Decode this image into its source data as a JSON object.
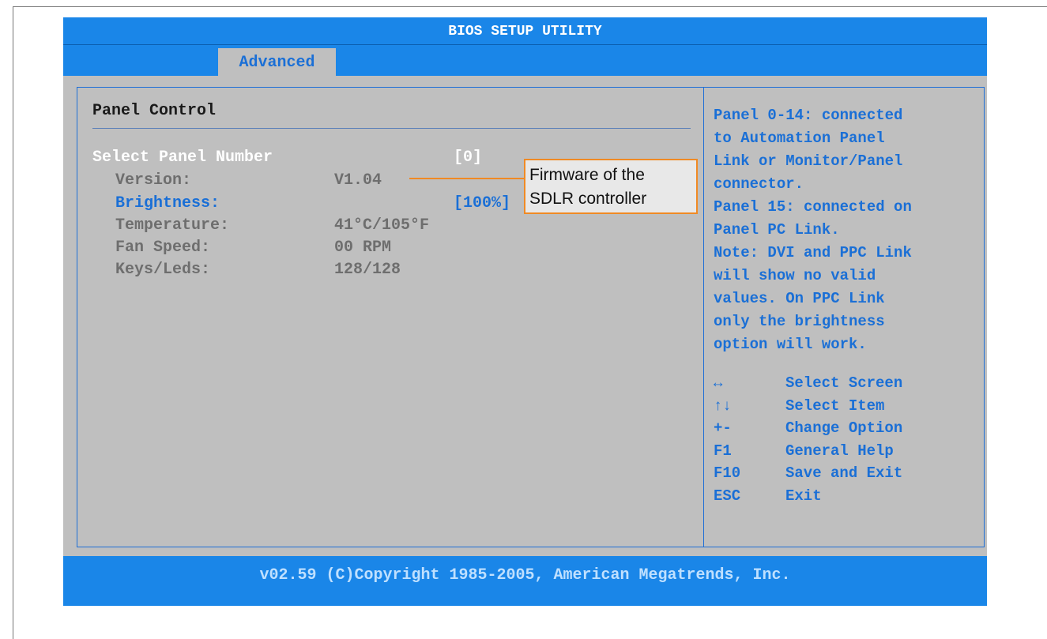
{
  "title": "BIOS SETUP UTILITY",
  "tabs": {
    "active": "Advanced"
  },
  "section": {
    "title": "Panel Control"
  },
  "items": {
    "panel_number": {
      "label": "Select Panel Number",
      "value": "[0]"
    },
    "version": {
      "label": "Version:",
      "value": "V1.04"
    },
    "brightness": {
      "label": "Brightness:",
      "value": "[100%]"
    },
    "temperature": {
      "label": "Temperature:",
      "value": "41°C/105°F"
    },
    "fan_speed": {
      "label": "Fan Speed:",
      "value": "00 RPM"
    },
    "keys_leds": {
      "label": "Keys/Leds:",
      "value": "128/128"
    }
  },
  "callout": {
    "line1": "Firmware of the",
    "line2": "SDLR controller"
  },
  "help_text": [
    "Panel 0-14: connected",
    "to Automation Panel",
    "Link or Monitor/Panel",
    "connector.",
    "Panel 15: connected on",
    "Panel PC Link.",
    "Note: DVI and PPC Link",
    "will show no valid",
    "values. On PPC Link",
    "only the brightness",
    "option will work."
  ],
  "keys": [
    {
      "key": "↔",
      "action": "Select Screen"
    },
    {
      "key": "↑↓",
      "action": "Select Item"
    },
    {
      "key": "+-",
      "action": "Change Option"
    },
    {
      "key": "F1",
      "action": "General Help"
    },
    {
      "key": "F10",
      "action": "Save and Exit"
    },
    {
      "key": "ESC",
      "action": "Exit"
    }
  ],
  "footer": "v02.59 (C)Copyright 1985-2005, American Megatrends, Inc.",
  "colors": {
    "accent": "#1a86e8",
    "panel": "#bfbfbf",
    "callout_border": "#f08a24"
  }
}
